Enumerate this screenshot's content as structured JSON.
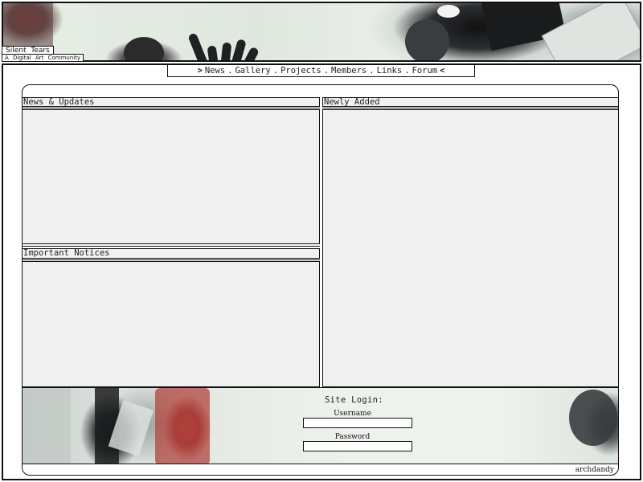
{
  "header": {
    "site_title": "Silent Tears",
    "tagline": "A Digital Art Community"
  },
  "nav": {
    "open_arrow": ">",
    "close_arrow": "<",
    "separator": ".",
    "items": [
      {
        "label": "News"
      },
      {
        "label": "Gallery"
      },
      {
        "label": "Projects"
      },
      {
        "label": "Members"
      },
      {
        "label": "Links"
      },
      {
        "label": "Forum"
      }
    ]
  },
  "panels": {
    "news": {
      "title": "News & Updates"
    },
    "notices": {
      "title": "Important Notices"
    },
    "newly_added": {
      "title": "Newly Added"
    }
  },
  "login": {
    "title": "Site Login:",
    "username_label": "Username",
    "username_value": "",
    "password_label": "Password",
    "password_value": ""
  },
  "footer": {
    "credit": "archdandy"
  },
  "colors": {
    "border": "#111111",
    "panel_background": "#f0f0f0",
    "page_background": "#ffffff",
    "banner_red_accent": "#8d3a36"
  }
}
